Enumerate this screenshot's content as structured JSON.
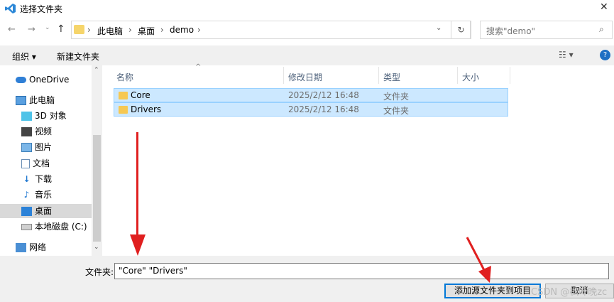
{
  "window": {
    "title": "选择文件夹"
  },
  "address": {
    "crumbs": [
      "此电脑",
      "桌面",
      "demo"
    ]
  },
  "search": {
    "placeholder": "搜索\"demo\""
  },
  "toolbar": {
    "organize": "组织 ▾",
    "new_folder": "新建文件夹"
  },
  "sidebar": {
    "items": [
      {
        "label": "OneDrive",
        "icon": "cloud-icon"
      },
      {
        "label": "此电脑",
        "icon": "computer-icon"
      },
      {
        "label": "3D 对象",
        "icon": "cube-icon"
      },
      {
        "label": "视频",
        "icon": "video-icon"
      },
      {
        "label": "图片",
        "icon": "picture-icon"
      },
      {
        "label": "文档",
        "icon": "document-icon"
      },
      {
        "label": "下载",
        "icon": "download-icon"
      },
      {
        "label": "音乐",
        "icon": "music-icon"
      },
      {
        "label": "桌面",
        "icon": "desktop-icon"
      },
      {
        "label": "本地磁盘 (C:)",
        "icon": "drive-icon"
      },
      {
        "label": "网络",
        "icon": "network-icon"
      }
    ]
  },
  "columns": {
    "name": "名称",
    "modified": "修改日期",
    "type": "类型",
    "size": "大小"
  },
  "files": [
    {
      "name": "Core",
      "modified": "2025/2/12 16:48",
      "type": "文件夹"
    },
    {
      "name": "Drivers",
      "modified": "2025/2/12 16:48",
      "type": "文件夹"
    }
  ],
  "footer": {
    "folder_label": "文件夹:",
    "folder_value": "\"Core\" \"Drivers\"",
    "confirm_button": "添加源文件夹到项目",
    "cancel_button": "取消"
  },
  "watermark": "CSDN @枫叶晚zc",
  "colors": {
    "selection": "#cce8ff",
    "accent": "#0078d7",
    "annotation_arrow": "#e01f1f"
  }
}
